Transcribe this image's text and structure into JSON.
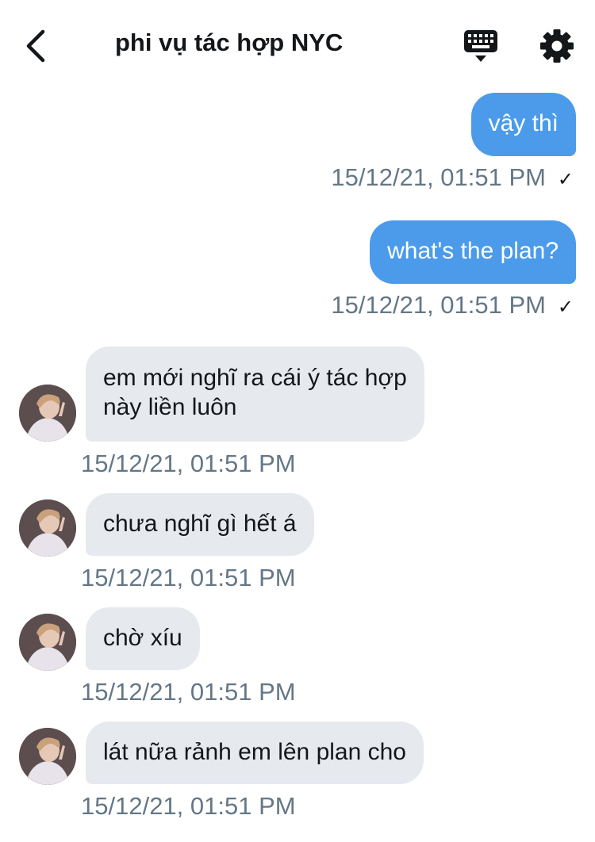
{
  "header": {
    "title": "phi vụ tác hợp NYC",
    "back_icon": "chevron-left-icon",
    "keyboard_icon": "keyboard-icon",
    "settings_icon": "gear-icon"
  },
  "messages": [
    {
      "direction": "out",
      "text": "vậy thì",
      "timestamp": "15/12/21, 01:51 PM",
      "read_mark": "✓"
    },
    {
      "direction": "out",
      "text": "what's the plan?",
      "timestamp": "15/12/21, 01:51 PM",
      "read_mark": "✓"
    },
    {
      "direction": "in",
      "text_line1": "em mới nghĩ ra cái ý tác hợp",
      "text_line2": "này liền luôn",
      "timestamp": "15/12/21, 01:51 PM"
    },
    {
      "direction": "in",
      "text": "chưa nghĩ gì hết á",
      "timestamp": "15/12/21, 01:51 PM"
    },
    {
      "direction": "in",
      "text": "chờ xíu",
      "timestamp": "15/12/21, 01:51 PM"
    },
    {
      "direction": "in",
      "text": "lát nữa rảnh em lên plan cho",
      "timestamp": "15/12/21, 01:51 PM"
    }
  ],
  "colors": {
    "outgoing_bubble": "#4b9bea",
    "incoming_bubble": "#e6e9ee",
    "timestamp": "#657786"
  }
}
